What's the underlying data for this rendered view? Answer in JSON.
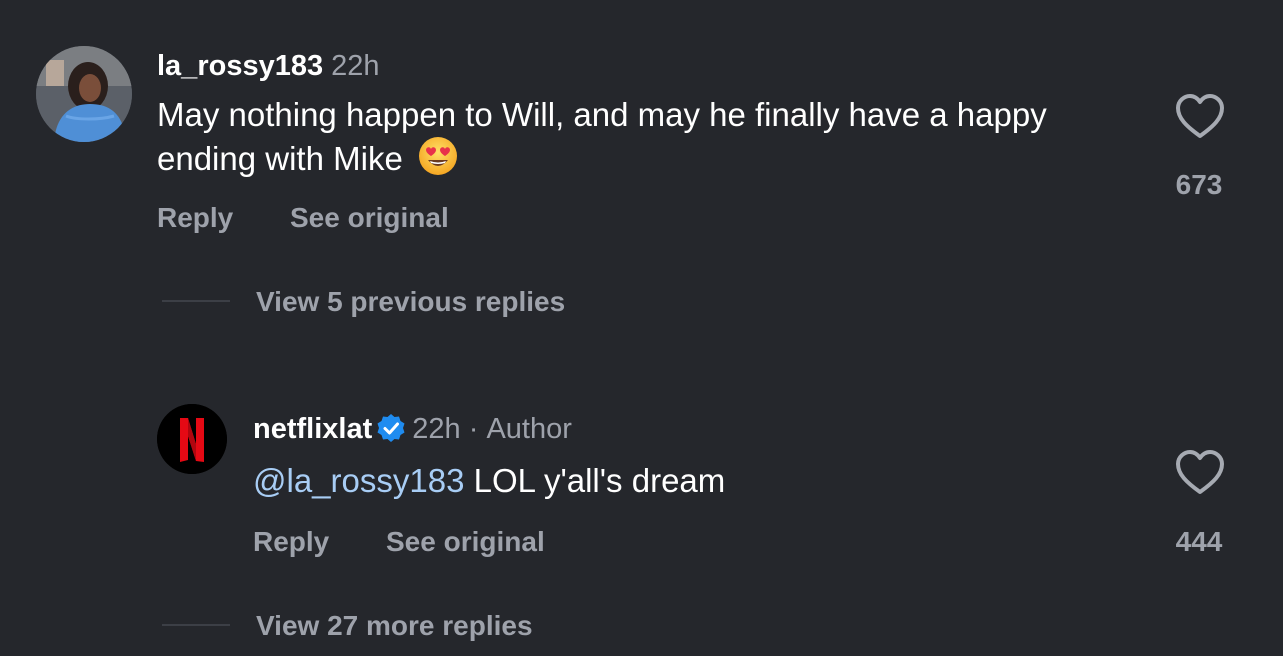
{
  "colors": {
    "background": "#25272c",
    "secondary_text": "#9ea2ab",
    "mention": "#a8cdf5",
    "verified": "#1f8cf0",
    "netflix_red": "#e50914"
  },
  "comments": [
    {
      "username": "la_rossy183",
      "time": "22h",
      "text": "May nothing happen to Will, and may he finally have a happy ending with Mike",
      "emoji": "smiling-face-with-heart-eyes",
      "reply_label": "Reply",
      "see_original_label": "See original",
      "like_count": "673",
      "avatar": "user-photo-avatar"
    }
  ],
  "view_previous_replies": "View 5 previous replies",
  "reply": {
    "username": "netflixlat",
    "verified": true,
    "time": "22h",
    "separator": "·",
    "author_badge": "Author",
    "mention": "@la_rossy183",
    "text": " LOL y'all's dream",
    "reply_label": "Reply",
    "see_original_label": "See original",
    "like_count": "444",
    "avatar": "netflix-logo-avatar"
  },
  "view_more_replies": "View 27 more replies"
}
